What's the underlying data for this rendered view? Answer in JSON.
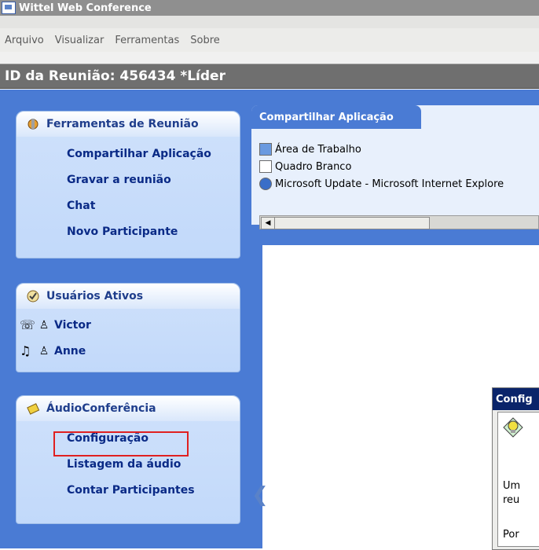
{
  "window": {
    "title": "Wittel Web Conference"
  },
  "menu": [
    "Arquivo",
    "Visualizar",
    "Ferramentas",
    "Sobre"
  ],
  "meeting": {
    "title": "ID da Reunião: 456434 *Líder"
  },
  "tools_panel": {
    "title": "Ferramentas de Reunião",
    "items": [
      "Compartilhar Aplicação",
      "Gravar a reunião",
      "Chat",
      "Novo Participante"
    ]
  },
  "users_panel": {
    "title": "Usuários Ativos",
    "users": [
      {
        "name": "Victor",
        "status_icon": "phone-icon",
        "role_icon": "leader-user-icon"
      },
      {
        "name": "Anne",
        "status_icon": "music-note-icon",
        "role_icon": "user-icon"
      }
    ]
  },
  "audio_panel": {
    "title": "ÁudioConferência",
    "items": [
      "Configuração",
      "Listagem da áudio",
      "Contar Participantes"
    ]
  },
  "share": {
    "tab_label": "Compartilhar Aplicação",
    "items": [
      "Área de Trabalho",
      "Quadro Branco",
      "Microsoft Update - Microsoft Internet Explore"
    ]
  },
  "dialog": {
    "title": "Config",
    "text_line1": "Um",
    "text_line2": "reu",
    "text_line3": "Por"
  },
  "colors": {
    "sidebar": "#4a7bd4",
    "link": "#0a2a86",
    "highlight": "#e02020"
  }
}
